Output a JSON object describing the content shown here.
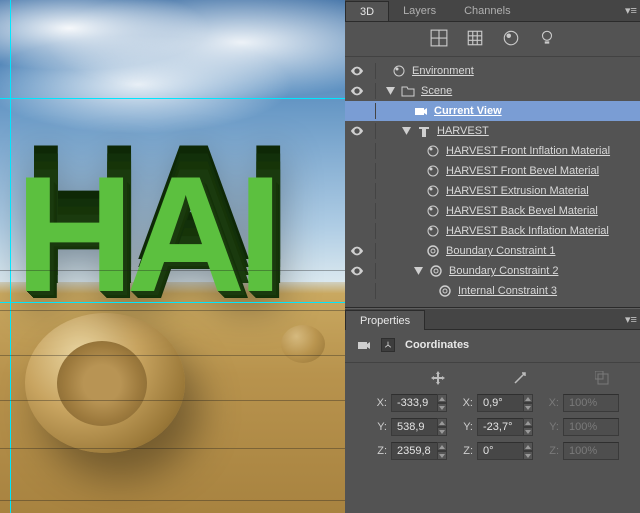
{
  "tabs": {
    "t3d": "3D",
    "layers": "Layers",
    "channels": "Channels"
  },
  "preview_text": "HAI",
  "tree": {
    "env": "Environment",
    "scene": "Scene",
    "current_view": "Current View",
    "harvest": "HARVEST",
    "mat_front_infl": "HARVEST Front Inflation Material",
    "mat_front_bevel": "HARVEST Front Bevel Material",
    "mat_extrusion": "HARVEST Extrusion Material",
    "mat_back_bevel": "HARVEST Back Bevel Material",
    "mat_back_infl": "HARVEST Back Inflation Material",
    "bc1": "Boundary Constraint 1",
    "bc2": "Boundary Constraint 2",
    "ic3": "Internal Constraint 3"
  },
  "props": {
    "panel": "Properties",
    "section": "Coordinates",
    "axes": {
      "x": "X:",
      "y": "Y:",
      "z": "Z:"
    },
    "pos": {
      "x": "-333,9",
      "y": "538,9",
      "z": "2359,8"
    },
    "rot": {
      "x": "0,9°",
      "y": "-23,7°",
      "z": "0°"
    },
    "scale": {
      "x": "100%",
      "y": "100%",
      "z": "100%"
    }
  }
}
